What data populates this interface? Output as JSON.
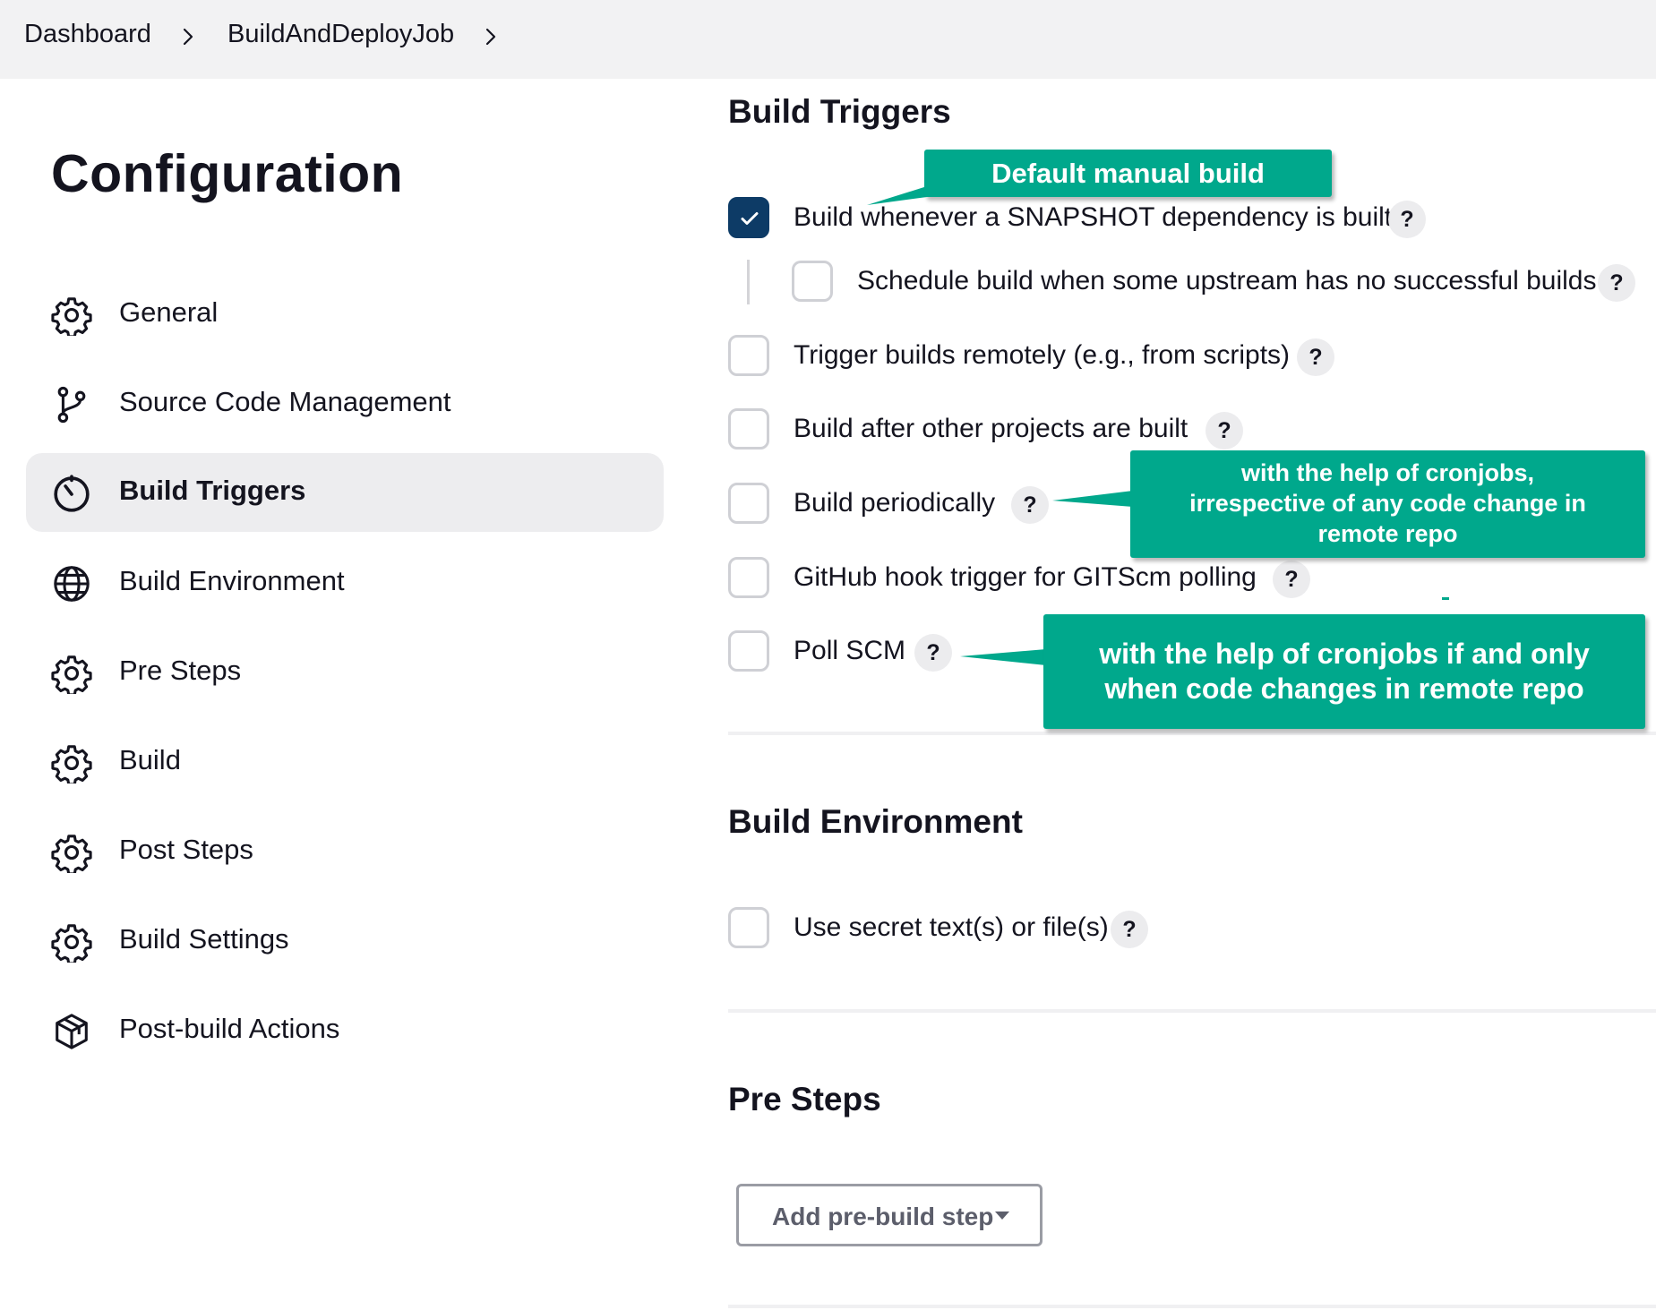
{
  "breadcrumb": {
    "items": [
      "Dashboard",
      "BuildAndDeployJob"
    ]
  },
  "page": {
    "title": "Configuration"
  },
  "sidebar": {
    "items": [
      {
        "label": "General",
        "icon": "gear-icon",
        "active": false
      },
      {
        "label": "Source Code Management",
        "icon": "git-branch-icon",
        "active": false
      },
      {
        "label": "Build Triggers",
        "icon": "timer-icon",
        "active": true
      },
      {
        "label": "Build Environment",
        "icon": "globe-icon",
        "active": false
      },
      {
        "label": "Pre Steps",
        "icon": "gear-icon",
        "active": false
      },
      {
        "label": "Build",
        "icon": "gear-icon",
        "active": false
      },
      {
        "label": "Post Steps",
        "icon": "gear-icon",
        "active": false
      },
      {
        "label": "Build Settings",
        "icon": "gear-icon",
        "active": false
      },
      {
        "label": "Post-build Actions",
        "icon": "package-icon",
        "active": false
      }
    ]
  },
  "build_triggers": {
    "title": "Build Triggers",
    "options": [
      {
        "label": "Build whenever a SNAPSHOT dependency is built",
        "checked": true
      },
      {
        "label": "Schedule build when some upstream has no successful builds",
        "checked": false,
        "nested": true
      },
      {
        "label": "Trigger builds remotely (e.g., from scripts)",
        "checked": false
      },
      {
        "label": "Build after other projects are built",
        "checked": false
      },
      {
        "label": "Build periodically",
        "checked": false
      },
      {
        "label": "GitHub hook trigger for GITScm polling",
        "checked": false
      },
      {
        "label": "Poll SCM",
        "checked": false
      }
    ],
    "help_glyph": "?"
  },
  "build_environment": {
    "title": "Build Environment",
    "options": [
      {
        "label": "Use secret text(s) or file(s)",
        "checked": false
      }
    ]
  },
  "pre_steps": {
    "title": "Pre Steps",
    "add_button_label": "Add pre-build step"
  },
  "annotations": {
    "default_manual": "Default manual build",
    "periodic": [
      "with the help of cronjobs,",
      "irrespective of any code change in",
      "remote repo"
    ],
    "poll_scm": [
      "with the help of cronjobs if and only",
      "when code changes in remote repo"
    ]
  },
  "colors": {
    "accent_checkbox": "#0d3b66",
    "callout": "#00a88c",
    "active_nav": "#ededef"
  }
}
